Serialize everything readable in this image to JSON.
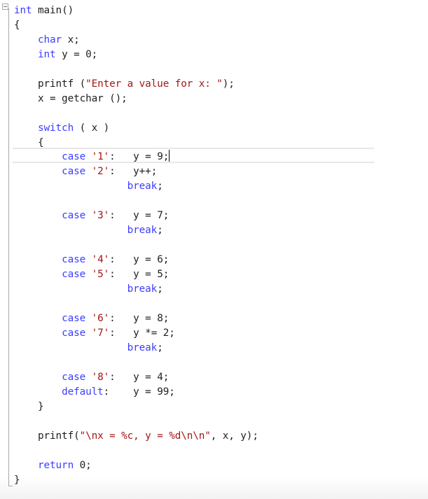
{
  "editor": {
    "colors": {
      "keyword": "#3c3cff",
      "string": "#a31515",
      "text": "#1e1e1e",
      "background": "#ffffff",
      "gutter": "#a8a8a8"
    },
    "current_line_index": 10,
    "lines": [
      [
        {
          "t": "int",
          "c": "kw"
        },
        {
          "t": " main()",
          "c": ""
        }
      ],
      [
        {
          "t": "{",
          "c": ""
        }
      ],
      [
        {
          "t": "    ",
          "c": ""
        },
        {
          "t": "char",
          "c": "kw"
        },
        {
          "t": " x;",
          "c": ""
        }
      ],
      [
        {
          "t": "    ",
          "c": ""
        },
        {
          "t": "int",
          "c": "kw"
        },
        {
          "t": " y = 0;",
          "c": ""
        }
      ],
      [],
      [
        {
          "t": "    printf (",
          "c": ""
        },
        {
          "t": "\"Enter a value for x: \"",
          "c": "str"
        },
        {
          "t": ");",
          "c": ""
        }
      ],
      [
        {
          "t": "    x = getchar ();",
          "c": ""
        }
      ],
      [],
      [
        {
          "t": "    ",
          "c": ""
        },
        {
          "t": "switch",
          "c": "kw"
        },
        {
          "t": " ( x )",
          "c": ""
        }
      ],
      [
        {
          "t": "    {",
          "c": ""
        }
      ],
      [
        {
          "t": "        ",
          "c": ""
        },
        {
          "t": "case",
          "c": "kw"
        },
        {
          "t": " ",
          "c": ""
        },
        {
          "t": "'1'",
          "c": "str"
        },
        {
          "t": ":   y = 9;",
          "c": ""
        }
      ],
      [
        {
          "t": "        ",
          "c": ""
        },
        {
          "t": "case",
          "c": "kw"
        },
        {
          "t": " ",
          "c": ""
        },
        {
          "t": "'2'",
          "c": "str"
        },
        {
          "t": ":   y++;",
          "c": ""
        }
      ],
      [
        {
          "t": "                   ",
          "c": ""
        },
        {
          "t": "break",
          "c": "kw"
        },
        {
          "t": ";",
          "c": ""
        }
      ],
      [],
      [],
      [
        {
          "t": "        ",
          "c": ""
        },
        {
          "t": "case",
          "c": "kw"
        },
        {
          "t": " ",
          "c": ""
        },
        {
          "t": "'3'",
          "c": "str"
        },
        {
          "t": ":   y = 7;",
          "c": ""
        }
      ],
      [
        {
          "t": "                   ",
          "c": ""
        },
        {
          "t": "break",
          "c": "kw"
        },
        {
          "t": ";",
          "c": ""
        }
      ],
      [],
      [
        {
          "t": "        ",
          "c": ""
        },
        {
          "t": "case",
          "c": "kw"
        },
        {
          "t": " ",
          "c": ""
        },
        {
          "t": "'4'",
          "c": "str"
        },
        {
          "t": ":   y = 6;",
          "c": ""
        }
      ],
      [
        {
          "t": "        ",
          "c": ""
        },
        {
          "t": "case",
          "c": "kw"
        },
        {
          "t": " ",
          "c": ""
        },
        {
          "t": "'5'",
          "c": "str"
        },
        {
          "t": ":   y = 5;",
          "c": ""
        }
      ],
      [
        {
          "t": "                   ",
          "c": ""
        },
        {
          "t": "break",
          "c": "kw"
        },
        {
          "t": ";",
          "c": ""
        }
      ],
      [],
      [
        {
          "t": "        ",
          "c": ""
        },
        {
          "t": "case",
          "c": "kw"
        },
        {
          "t": " ",
          "c": ""
        },
        {
          "t": "'6'",
          "c": "str"
        },
        {
          "t": ":   y = 8;",
          "c": ""
        }
      ],
      [
        {
          "t": "        ",
          "c": ""
        },
        {
          "t": "case",
          "c": "kw"
        },
        {
          "t": " ",
          "c": ""
        },
        {
          "t": "'7'",
          "c": "str"
        },
        {
          "t": ":   y *= 2;",
          "c": ""
        }
      ],
      [
        {
          "t": "                   ",
          "c": ""
        },
        {
          "t": "break",
          "c": "kw"
        },
        {
          "t": ";",
          "c": ""
        }
      ],
      [],
      [
        {
          "t": "        ",
          "c": ""
        },
        {
          "t": "case",
          "c": "kw"
        },
        {
          "t": " ",
          "c": ""
        },
        {
          "t": "'8'",
          "c": "str"
        },
        {
          "t": ":   y = 4;",
          "c": ""
        }
      ],
      [
        {
          "t": "        ",
          "c": ""
        },
        {
          "t": "default",
          "c": "kw"
        },
        {
          "t": ":    y = 99;",
          "c": ""
        }
      ],
      [
        {
          "t": "    }",
          "c": ""
        }
      ],
      [],
      [
        {
          "t": "    printf(",
          "c": ""
        },
        {
          "t": "\"\\nx = %c, y = %d\\n\\n\"",
          "c": "str"
        },
        {
          "t": ", x, y);",
          "c": ""
        }
      ],
      [],
      [
        {
          "t": "    ",
          "c": ""
        },
        {
          "t": "return",
          "c": "kw"
        },
        {
          "t": " 0;",
          "c": ""
        }
      ],
      [
        {
          "t": "}",
          "c": ""
        }
      ]
    ]
  }
}
